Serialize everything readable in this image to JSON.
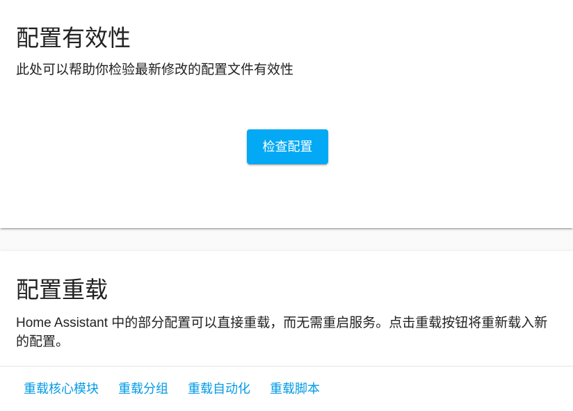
{
  "validation_card": {
    "title": "配置有效性",
    "description": "此处可以帮助你检验最新修改的配置文件有效性",
    "check_button_label": "检查配置"
  },
  "reload_card": {
    "title": "配置重载",
    "description": "Home Assistant 中的部分配置可以直接重载，而无需重启服务。点击重载按钮将重新载入新的配置。",
    "actions": [
      "重载核心模块",
      "重载分组",
      "重载自动化",
      "重载脚本"
    ]
  },
  "colors": {
    "primary": "#03a9f4",
    "link": "#039be5",
    "text": "#212121",
    "background": "#fafafa"
  }
}
